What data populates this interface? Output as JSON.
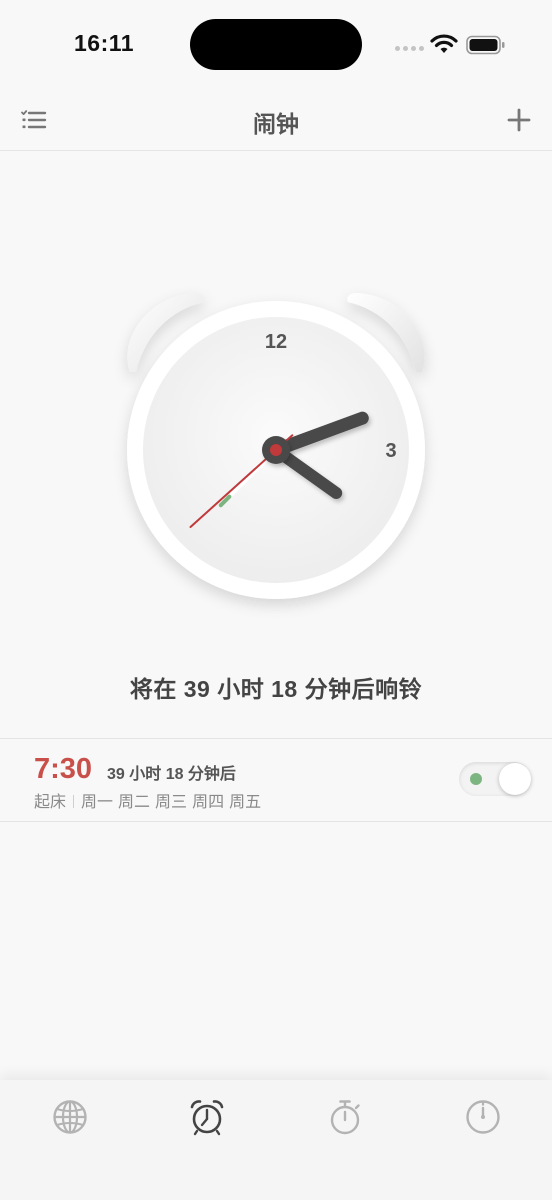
{
  "status_bar": {
    "time": "16:11",
    "icons": [
      "cellular-signal-icon",
      "wifi-icon",
      "battery-icon"
    ]
  },
  "nav": {
    "title": "闹钟",
    "left_icon": "list-icon",
    "right_icon": "plus-icon"
  },
  "clock": {
    "numerals": [
      "12",
      "3"
    ],
    "time_shown": {
      "hour": 16,
      "minute": 11,
      "second": 38
    },
    "colors": {
      "second_hand": "#c0393b",
      "alarm_marker": "#7db581",
      "hands": "#4a4a4a"
    }
  },
  "countdown": {
    "text": "将在 39 小时 18 分钟后响铃"
  },
  "alarm": {
    "time": "7:30",
    "remaining": "39 小时 18 分钟后",
    "label": "起床",
    "days": [
      "周一",
      "周二",
      "周三",
      "周四",
      "周五"
    ],
    "enabled": true,
    "accent_color": "#c9504a"
  },
  "tab_bar": {
    "tabs": [
      {
        "icon": "globe-icon",
        "active": false
      },
      {
        "icon": "alarm-clock-icon",
        "active": true
      },
      {
        "icon": "stopwatch-icon",
        "active": false
      },
      {
        "icon": "timer-icon",
        "active": false
      }
    ]
  }
}
